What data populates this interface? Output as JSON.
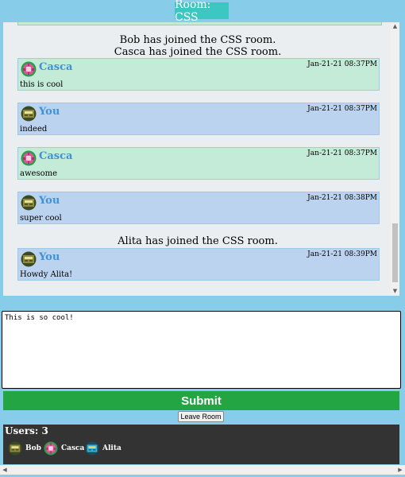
{
  "room": {
    "title": "Room: CSS"
  },
  "chat": {
    "system_messages": [
      "Bob has joined the CSS room.",
      "Casca has joined the CSS room.",
      "Alita has joined the CSS room."
    ],
    "messages": [
      {
        "author": "Casca",
        "time": "Jan-21-21 08:37PM",
        "text": "this is cool",
        "avatar": "pink-gem-avatar-icon"
      },
      {
        "author": "You",
        "time": "Jan-21-21 08:37PM",
        "text": "indeed",
        "avatar": "olive-robot-avatar-icon"
      },
      {
        "author": "Casca",
        "time": "Jan-21-21 08:37PM",
        "text": "awesome",
        "avatar": "pink-gem-avatar-icon"
      },
      {
        "author": "You",
        "time": "Jan-21-21 08:38PM",
        "text": "super cool",
        "avatar": "olive-robot-avatar-icon"
      },
      {
        "author": "You",
        "time": "Jan-21-21 08:39PM",
        "text": "Howdy Alita!",
        "avatar": "olive-robot-avatar-icon"
      }
    ]
  },
  "input": {
    "value": "This is so cool!"
  },
  "actions": {
    "submit_label": "Submit",
    "leave_label": "Leave Room"
  },
  "users": {
    "count_label": "Users: 3",
    "list": [
      {
        "name": "Bob",
        "avatar": "olive-robot-avatar-icon"
      },
      {
        "name": "Casca",
        "avatar": "pink-gem-avatar-icon"
      },
      {
        "name": "Alita",
        "avatar": "teal-robot-avatar-icon"
      }
    ]
  },
  "colors": {
    "page_bg": "#87cde9",
    "room_badge": "#3cc7c2",
    "other_msg_bg": "#c3ebd7",
    "self_msg_bg": "#bcd3ef",
    "name_color": "#3d93d6",
    "submit_bg": "#23a544",
    "users_panel_bg": "#333333"
  }
}
